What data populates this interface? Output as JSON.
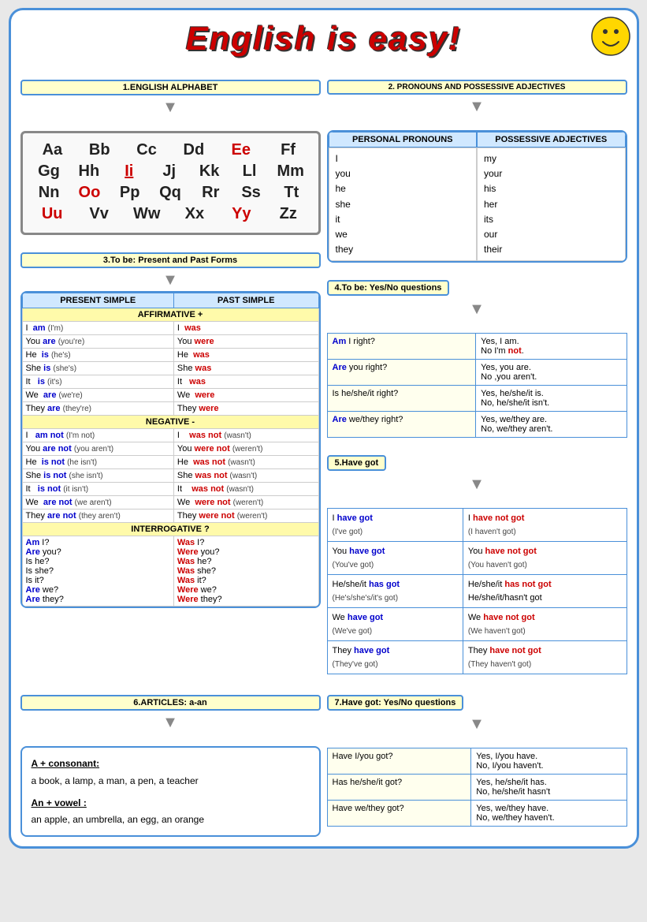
{
  "title": "English is easy!",
  "sections": {
    "alphabet": {
      "label": "1.ENGLISH ALPHABET",
      "rows": [
        [
          {
            "l": "Aa",
            "red": false
          },
          {
            "l": "Bb",
            "red": false
          },
          {
            "l": "Cc",
            "red": false
          },
          {
            "l": "Dd",
            "red": false
          },
          {
            "l": "Ee",
            "red": true
          },
          {
            "l": "Ff",
            "red": false
          }
        ],
        [
          {
            "l": "Gg",
            "red": false
          },
          {
            "l": "Hh",
            "red": false
          },
          {
            "l": "Ii",
            "red": true
          },
          {
            "l": "Jj",
            "red": false
          },
          {
            "l": "Kk",
            "red": false
          },
          {
            "l": "Ll",
            "red": false
          },
          {
            "l": "Mm",
            "red": false
          }
        ],
        [
          {
            "l": "Nn",
            "red": false
          },
          {
            "l": "Oo",
            "red": true
          },
          {
            "l": "Pp",
            "red": false
          },
          {
            "l": "Qq",
            "red": false
          },
          {
            "l": "Rr",
            "red": false
          },
          {
            "l": "Ss",
            "red": false
          },
          {
            "l": "Tt",
            "red": false
          }
        ],
        [
          {
            "l": "Uu",
            "red": true
          },
          {
            "l": "Vv",
            "red": false
          },
          {
            "l": "Ww",
            "red": false
          },
          {
            "l": "Xx",
            "red": false
          },
          {
            "l": "Yy",
            "red": true
          },
          {
            "l": "Zz",
            "red": false
          }
        ]
      ]
    },
    "pronouns": {
      "label": "2. PRONOUNS AND POSSESSIVE ADJECTIVES",
      "col1_header": "PERSONAL PRONOUNS",
      "col2_header": "POSSESSIVE ADJECTIVES",
      "col1": [
        "I",
        "you",
        "he",
        "she",
        "it",
        "we",
        "they"
      ],
      "col2": [
        "my",
        "your",
        "his",
        "her",
        "its",
        "our",
        "their"
      ]
    },
    "tobe": {
      "label": "3.To be: Present and Past Forms",
      "present_header": "PRESENT SIMPLE",
      "past_header": "PAST SIMPLE",
      "affirmative_label": "AFFIRMATIVE +",
      "negative_label": "NEGATIVE -",
      "interrogative_label": "INTERROGATIVE ?",
      "affirmative_present": [
        {
          "subj": "I",
          "verb": "am",
          "short": "(I'm)"
        },
        {
          "subj": "You",
          "verb": "are",
          "short": "(you're)"
        },
        {
          "subj": "He",
          "verb": "is",
          "short": "(he's)"
        },
        {
          "subj": "She",
          "verb": "is",
          "short": "(she's)"
        },
        {
          "subj": "It",
          "verb": "is",
          "short": "(it's)"
        },
        {
          "subj": "We",
          "verb": "are",
          "short": "(we're)"
        },
        {
          "subj": "They",
          "verb": "are",
          "short": "(they're)"
        }
      ],
      "affirmative_past": [
        {
          "subj": "I",
          "verb": "was",
          "short": ""
        },
        {
          "subj": "You",
          "verb": "were",
          "short": ""
        },
        {
          "subj": "He",
          "verb": "was",
          "short": ""
        },
        {
          "subj": "She",
          "verb": "was",
          "short": ""
        },
        {
          "subj": "It",
          "verb": "was",
          "short": ""
        },
        {
          "subj": "We",
          "verb": "were",
          "short": ""
        },
        {
          "subj": "They",
          "verb": "were",
          "short": ""
        }
      ],
      "negative_present": [
        {
          "subj": "I",
          "verb": "am not",
          "short": "(I'm not)"
        },
        {
          "subj": "You",
          "verb": "are not",
          "short": "(you aren't)"
        },
        {
          "subj": "He",
          "verb": "is not",
          "short": "(he isn't)"
        },
        {
          "subj": "She",
          "verb": "is not",
          "short": "(she isn't)"
        },
        {
          "subj": "It",
          "verb": "is not",
          "short": "(it isn't)"
        },
        {
          "subj": "We",
          "verb": "are not",
          "short": "(we aren't)"
        },
        {
          "subj": "They",
          "verb": "are not",
          "short": "(they aren't)"
        }
      ],
      "negative_past": [
        {
          "subj": "I",
          "verb": "was not",
          "short": "(wasn't)"
        },
        {
          "subj": "You",
          "verb": "were not",
          "short": "(weren't)"
        },
        {
          "subj": "He",
          "verb": "was not",
          "short": "(wasn't)"
        },
        {
          "subj": "She",
          "verb": "was not",
          "short": "(wasn't)"
        },
        {
          "subj": "It",
          "verb": "was not",
          "short": "(wasn't)"
        },
        {
          "subj": "We",
          "verb": "were not",
          "short": "(weren't)"
        },
        {
          "subj": "They",
          "verb": "were not",
          "short": "(weren't)"
        }
      ],
      "interrog_present": [
        "Am I?",
        "Are you?",
        "Is he?",
        "Is she?",
        "Is it?",
        "Are we?",
        "Are they?"
      ],
      "interrog_past": [
        "Was I?",
        "Were you?",
        "Was he?",
        "Was she?",
        "Was it?",
        "Were we?",
        "Were they?"
      ],
      "interrog_present_verbs": [
        "Am",
        "Are",
        "Is",
        "Is",
        "Is",
        "Are",
        "Are"
      ],
      "interrog_past_verbs": [
        "Was",
        "Were",
        "Was",
        "Was",
        "Was",
        "Were",
        "Were"
      ]
    },
    "yesno": {
      "label": "4.To be: Yes/No questions",
      "rows": [
        {
          "q": "Am I right?",
          "a": "Yes, I am.\nNo I'm not."
        },
        {
          "q": "Are you right?",
          "a": "Yes, you are.\nNo ,you aren't."
        },
        {
          "q": "Is he/she/it right?",
          "a": "Yes, he/she/it is.\nNo, he/she/it isn't."
        },
        {
          "q": "Are we/they right?",
          "a": "Yes, we/they are.\nNo, we/they aren't."
        }
      ],
      "q_verbs": [
        "Am",
        "Are",
        "Is",
        "Are"
      ]
    },
    "havegot": {
      "label": "5.Have got",
      "rows": [
        {
          "pos": "I have got\n(I've got)",
          "neg": "I have not got\n(I haven't got)"
        },
        {
          "pos": "You have got\n(You've got)",
          "neg": "You have not got\n(You haven't got)"
        },
        {
          "pos": "He/she/it has got\n(He's/she's/it's got)",
          "neg": "He/she/it has not got\nHe/she/it/hasn't got"
        },
        {
          "pos": "We have got\n(We've got)",
          "neg": "We have not got\n(We haven't got)"
        },
        {
          "pos": "They have got\n(They've got)",
          "neg": "They have not got\n(They haven't got)"
        }
      ]
    },
    "articles": {
      "label": "6.ARTICLES: a-an",
      "a_rule": "A + consonant:",
      "a_examples": "a book, a lamp, a man, a pen, a teacher",
      "an_rule": "An + vowel :",
      "an_examples": "an apple, an umbrella, an egg, an orange"
    },
    "havegot_yesno": {
      "label": "7.Have got: Yes/No questions",
      "rows": [
        {
          "q": "Have I/you got?",
          "a": "Yes, I/you have.\nNo, I/you haven't."
        },
        {
          "q": "Has he/she/it got?",
          "a": "Yes, he/she/it has.\nNo, he/she/it hasn't"
        },
        {
          "q": "Have we/they got?",
          "a": "Yes, we/they have.\nNo, we/they haven't."
        }
      ]
    }
  }
}
